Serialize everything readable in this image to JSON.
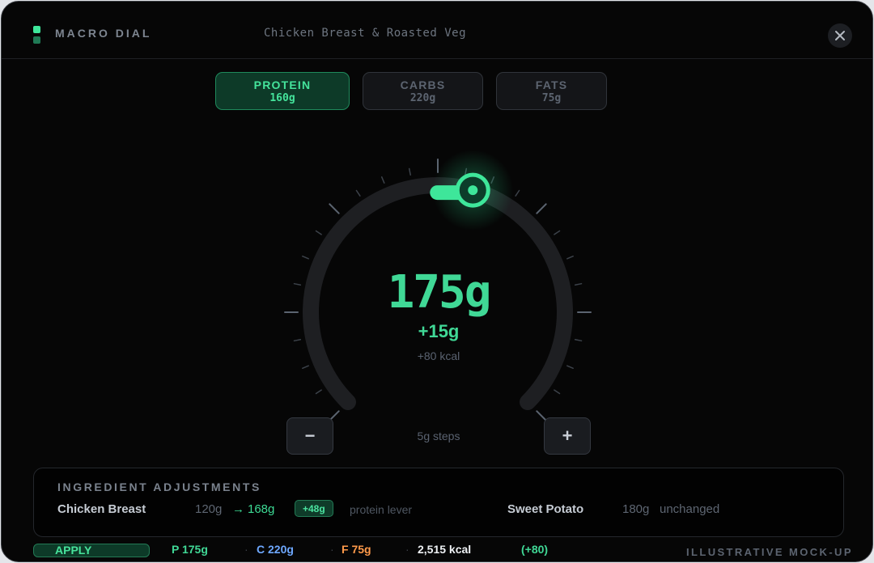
{
  "app": {
    "title": "MACRO DIAL",
    "meal_name": "Chicken Breast & Roasted Veg"
  },
  "tabs": [
    {
      "label": "PROTEIN",
      "value": "160g",
      "active": true
    },
    {
      "label": "CARBS",
      "value": "220g",
      "active": false
    },
    {
      "label": "FATS",
      "value": "75g",
      "active": false
    }
  ],
  "dial": {
    "value": "175g",
    "delta": "+15g",
    "kcal_delta": "+80 kcal",
    "step_label": "5g steps",
    "minus_label": "−",
    "plus_label": "+",
    "level_fraction": 0.5
  },
  "ingredients": {
    "heading": "INGREDIENT ADJUSTMENTS",
    "items": [
      {
        "name": "Chicken Breast",
        "from": "120g",
        "arrow": "→",
        "to": "168g",
        "badge": "+48g",
        "note": "protein lever"
      },
      {
        "name": "Sweet Potato",
        "amount": "180g",
        "status": "unchanged"
      }
    ]
  },
  "footer": {
    "apply_label": "APPLY",
    "protein": "P 175g",
    "carbs": "C 220g",
    "fats": "F 75g",
    "kcal": "2,515 kcal",
    "kcal_delta": "(+80)",
    "separator": "·",
    "mockup_label": "ILLUSTRATIVE MOCK-UP"
  },
  "colors": {
    "accent": "#40d896",
    "carbs": "#6ea8ff",
    "fats": "#ff9a4a",
    "background": "#060606"
  },
  "icons": {
    "close": "close-icon",
    "logo": "logo-icon",
    "dial_handle": "dial-handle-icon"
  }
}
